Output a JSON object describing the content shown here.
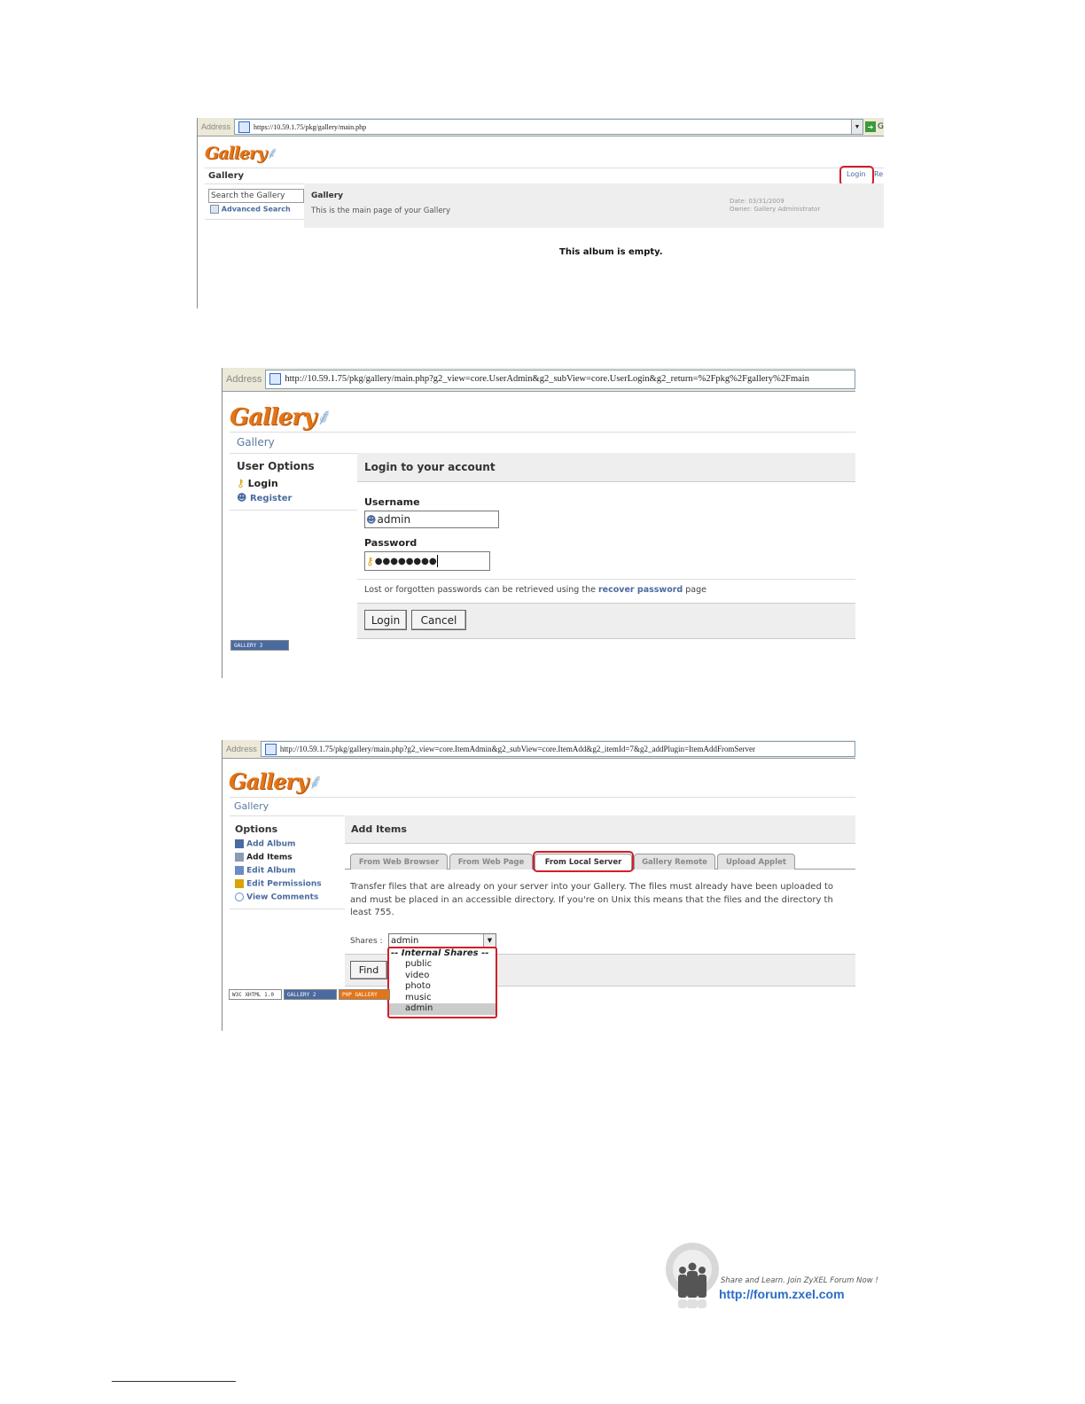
{
  "s1": {
    "address_label": "Address",
    "url": "https://10.59.1.75/pkg/gallery/main.php",
    "go_label": "G",
    "logo": "Gallery",
    "breadcrumb": "Gallery",
    "login_link": "Login",
    "register_partial": "Re",
    "search_placeholder": "Search the Gallery",
    "advanced_search": "Advanced Search",
    "album_title": "Gallery",
    "album_description": "This is the main page of your Gallery",
    "date_text": "Date: 03/31/2009",
    "owner_text": "Owner: Gallery Administrator",
    "empty_message": "This album is empty."
  },
  "s2": {
    "address_label": "Address",
    "url": "http://10.59.1.75/pkg/gallery/main.php?g2_view=core.UserAdmin&g2_subView=core.UserLogin&g2_return=%2Fpkg%2Fgallery%2Fmain",
    "logo": "Gallery",
    "breadcrumb": "Gallery",
    "sidebar_title": "User Options",
    "sidebar_login": "Login",
    "sidebar_register": "Register",
    "heading": "Login to your account",
    "username_label": "Username",
    "username_value": "admin",
    "password_label": "Password",
    "password_value": "●●●●●●●●",
    "recover_before": "Lost or forgotten passwords can be retrieved using the",
    "recover_link": "recover password",
    "recover_after": "page",
    "login_button": "Login",
    "cancel_button": "Cancel",
    "gallery_badge": "GALLERY 2"
  },
  "s3": {
    "address_label": "Address",
    "url": "http://10.59.1.75/pkg/gallery/main.php?g2_view=core.ItemAdmin&g2_subView=core.ItemAdd&g2_itemId=7&g2_addPlugin=ItemAddFromServer",
    "logo": "Gallery",
    "breadcrumb": "Gallery",
    "sidebar_title": "Options",
    "sidebar_items": [
      "Add Album",
      "Add Items",
      "Edit Album",
      "Edit Permissions",
      "View Comments"
    ],
    "heading": "Add Items",
    "tabs": [
      "From Web Browser",
      "From Web Page",
      "From Local Server",
      "Gallery Remote",
      "Upload Applet"
    ],
    "desc_line1": "Transfer files that are already on your server into your Gallery. The files must already have been uploaded to",
    "desc_line2": "and must be placed in an accessible directory. If you're on Unix this means that the files and the directory th",
    "desc_line3": "least 755.",
    "shares_label": "Shares :",
    "shares_selected": "admin",
    "dropdown_group": "-- Internal Shares --",
    "dropdown_options": [
      "public",
      "video",
      "photo",
      "music",
      "admin"
    ],
    "find_button": "Find",
    "badges": [
      "W3C XHTML 1.0",
      "GALLERY 2",
      "PHP GALLERY"
    ]
  },
  "footer": {
    "tagline": "Share and Learn. Join ZyXEL Forum Now !",
    "forum_url": "http://forum.zxel.com"
  }
}
